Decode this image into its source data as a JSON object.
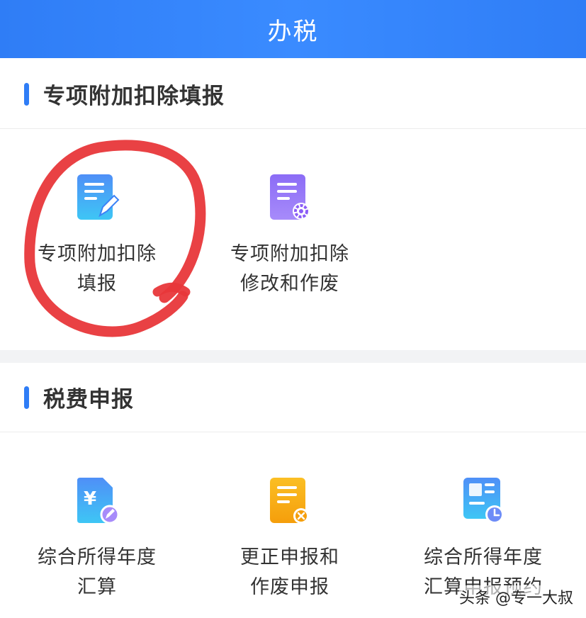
{
  "header": {
    "title": "办税"
  },
  "sections": [
    {
      "title": "专项附加扣除填报",
      "items": [
        {
          "line1": "专项附加扣除",
          "line2": "填报",
          "icon": "document-edit-icon"
        },
        {
          "line1": "专项附加扣除",
          "line2": "修改和作废",
          "icon": "document-settings-icon"
        }
      ]
    },
    {
      "title": "税费申报",
      "items": [
        {
          "line1": "综合所得年度",
          "line2": "汇算",
          "icon": "yuan-document-icon"
        },
        {
          "line1": "更正申报和",
          "line2": "作废申报",
          "icon": "document-cancel-icon"
        },
        {
          "line1": "综合所得年度",
          "line2": "汇算申报预约",
          "icon": "calendar-clock-icon"
        }
      ]
    }
  ],
  "watermark": "头条 @专一大叔",
  "colors": {
    "header_bg": "#2f7df6",
    "accent": "#2f7df6",
    "annotation_red": "#e8373a",
    "icon_blue": "#3b82f6",
    "icon_purple": "#8b5cf6",
    "icon_orange": "#f59e0b"
  }
}
